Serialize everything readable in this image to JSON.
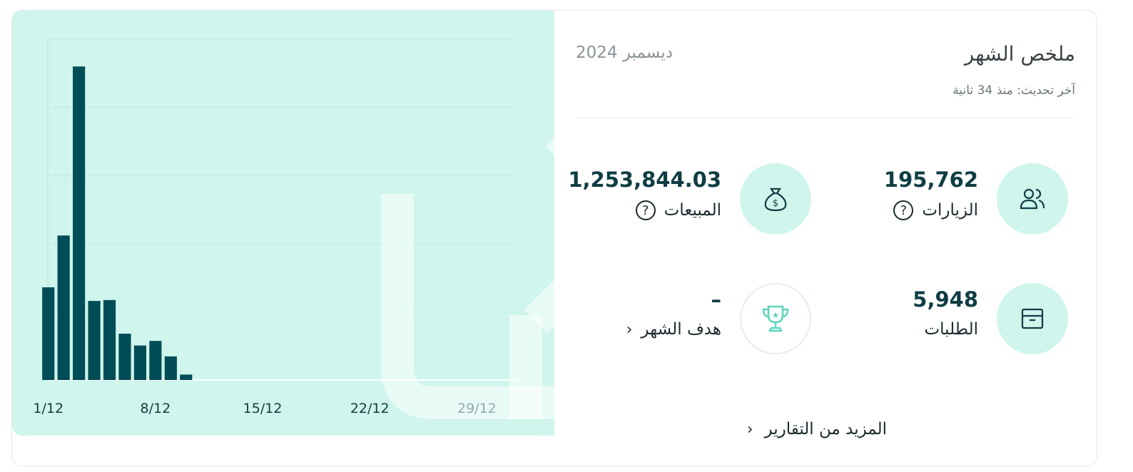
{
  "summary": {
    "title": "ملخص الشهر",
    "month": "ديسمبر 2024",
    "last_updated": "آخر تحديث: منذ 34 ثانية",
    "stats": {
      "visits": {
        "value": "195,762",
        "label": "الزيارات",
        "icon": "users-icon"
      },
      "sales": {
        "value": "1,253,844.03",
        "label": "المبيعات",
        "icon": "money-bag-icon"
      },
      "orders": {
        "value": "5,948",
        "label": "الطلبات",
        "icon": "box-icon"
      },
      "monthly_goal": {
        "value": "–",
        "label": "هدف الشهر",
        "icon": "trophy-icon"
      }
    },
    "help_glyph": "?",
    "chevron_glyph": "‹",
    "more_reports": "المزيد من التقارير"
  },
  "colors": {
    "accent_bg": "#cff5ec",
    "bar": "#004d57",
    "trophy": "#5fd6bf"
  },
  "chart_data": {
    "type": "bar",
    "x": [
      1,
      2,
      3,
      4,
      5,
      6,
      7,
      8,
      9,
      10
    ],
    "values": [
      10.2,
      15.9,
      34.5,
      8.7,
      8.8,
      5.1,
      3.8,
      4.3,
      2.6,
      0.6
    ],
    "xticks": [
      "1/12",
      "8/12",
      "15/12",
      "22/12",
      "29/12"
    ],
    "xtick_positions": [
      1,
      8,
      15,
      22,
      29
    ],
    "xlim": [
      0.5,
      31.5
    ],
    "ylim": [
      0,
      37.5
    ],
    "grid": true
  }
}
